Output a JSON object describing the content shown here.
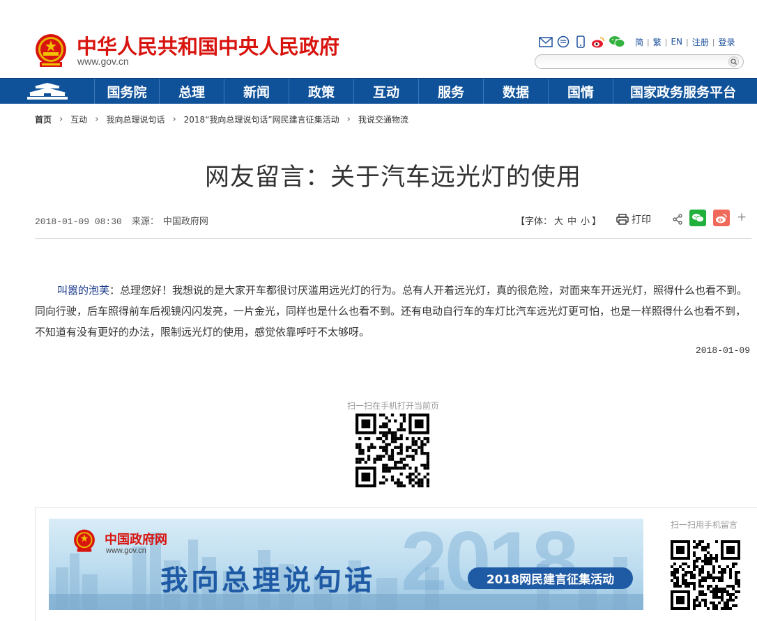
{
  "header": {
    "site_title": "中华人民共和国中央人民政府",
    "site_domain": "www.gov.cn",
    "tool_links": [
      "简",
      "繁",
      "EN",
      "注册",
      "登录"
    ],
    "search_placeholder": ""
  },
  "nav": {
    "items": [
      "国务院",
      "总理",
      "新闻",
      "政策",
      "互动",
      "服务",
      "数据",
      "国情",
      "国家政务服务平台"
    ],
    "bg_color": "#10529a"
  },
  "breadcrumb": [
    "首页",
    "互动",
    "我向总理说句话",
    "2018“我向总理说句话”网民建言征集活动",
    "我说交通物流"
  ],
  "article": {
    "title": "网友留言：关于汽车远光灯的使用",
    "date": "2018-01-09 08:30",
    "source_label": "来源：",
    "source": "中国政府网",
    "font_size_label": "【字体：",
    "font_sizes": [
      "大",
      "中",
      "小"
    ],
    "font_size_end": "】",
    "print_label": "打印",
    "author": "叫嚣的泡芙",
    "body": "：总理您好！我想说的是大家开车都很讨厌滥用远光灯的行为。总有人开着远光灯，真的很危险，对面来车开远光灯，照得什么也看不到。同向行驶，后车照得前车后视镜闪闪发亮，一片金光，同样也是什么也看不到。还有电动自行车的车灯比汽车远光灯更可怕，也是一样照得什么也看不到，不知道有没有更好的办法，限制远光灯的使用，感觉依靠呼吁不太够呀。",
    "post_date": "2018-01-09"
  },
  "qr": {
    "page_caption": "扫一扫在手机打开当前页",
    "message_caption": "扫一扫用手机留言"
  },
  "banner": {
    "logo_text": "中国政府网",
    "logo_domain": "www.gov.cn",
    "slogan": "我向总理说句话",
    "year": "2018",
    "pill": "2018网民建言征集活动"
  }
}
